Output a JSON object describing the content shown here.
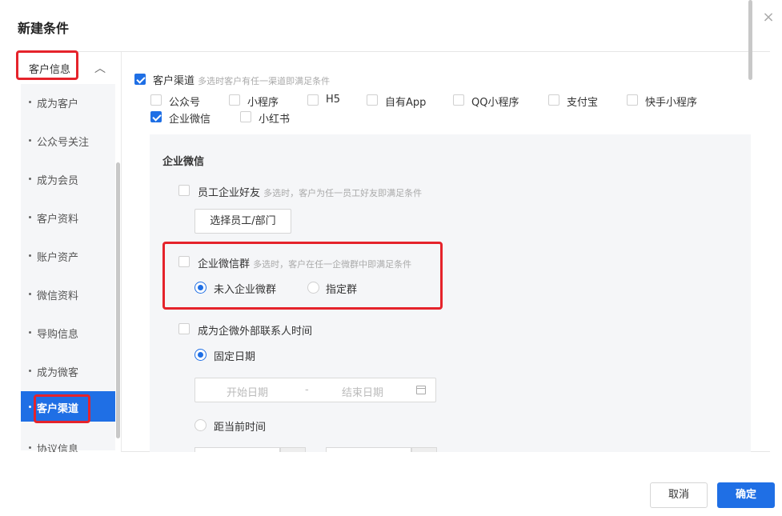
{
  "dialog": {
    "title": "新建条件",
    "close_glyph": "×"
  },
  "sidebar": {
    "group_label": "客户信息",
    "group_chevron": "︿",
    "items": [
      "成为客户",
      "公众号关注",
      "成为会员",
      "客户资料",
      "账户资产",
      "微信资料",
      "导购信息",
      "成为微客",
      "客户渠道",
      "协议信息"
    ],
    "active_index": 8
  },
  "channel": {
    "label": "客户渠道",
    "hint": "多选时客户有任一渠道即满足条件",
    "checked": true,
    "options": [
      {
        "label": "公众号",
        "checked": false
      },
      {
        "label": "小程序",
        "checked": false
      },
      {
        "label": "H5",
        "checked": false
      },
      {
        "label": "自有App",
        "checked": false
      },
      {
        "label": "QQ小程序",
        "checked": false
      },
      {
        "label": "支付宝",
        "checked": false
      },
      {
        "label": "快手小程序",
        "checked": false
      },
      {
        "label": "企业微信",
        "checked": true
      },
      {
        "label": "小红书",
        "checked": false
      }
    ]
  },
  "wecom": {
    "section_title": "企业微信",
    "friend": {
      "label": "员工企业好友",
      "hint": "多选时，客户为任一员工好友即满足条件",
      "checked": false,
      "button": "选择员工/部门"
    },
    "group": {
      "label": "企业微信群",
      "hint": "多选时，客户在任一企微群中即满足条件",
      "checked": false,
      "radios": [
        {
          "label": "未入企业微群",
          "selected": true
        },
        {
          "label": "指定群",
          "selected": false
        }
      ]
    },
    "contact_time": {
      "label": "成为企微外部联系人时间",
      "checked": false,
      "fixed_label": "固定日期",
      "fixed_selected": true,
      "start_placeholder": "开始日期",
      "separator": "-",
      "end_placeholder": "结束日期",
      "relative_label": "距当前时间",
      "relative_selected": false
    }
  },
  "footer": {
    "cancel": "取消",
    "confirm": "确定"
  },
  "colors": {
    "accent": "#1f6fe5",
    "annotation": "#e5232b",
    "panel_bg": "#f5f6f8"
  }
}
